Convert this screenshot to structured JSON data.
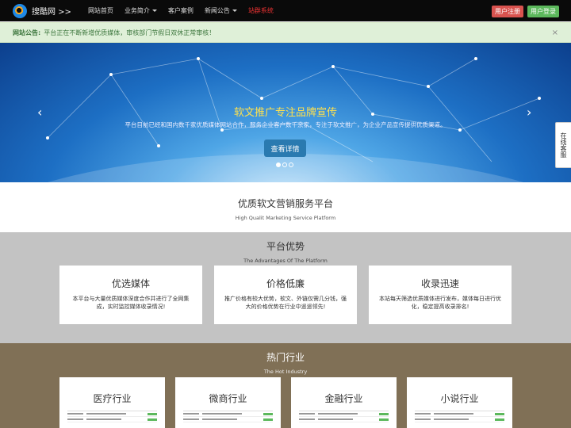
{
  "navbar": {
    "brand": "搜酷网 >>",
    "items": [
      {
        "label": "网站首页",
        "dropdown": false
      },
      {
        "label": "业务简介",
        "dropdown": true
      },
      {
        "label": "客户案例",
        "dropdown": false
      },
      {
        "label": "新闻公告",
        "dropdown": true
      },
      {
        "label": "站群系统",
        "dropdown": false,
        "highlight": true
      }
    ],
    "register": "用户注册",
    "login": "用户登录"
  },
  "notice": {
    "label": "网站公告:",
    "text": "平台正在不断新增优质媒体，审核部门节假日双休正常审核！",
    "close": "×"
  },
  "carousel": {
    "title": "软文推广专注品牌宣传",
    "subtitle": "平台目前已经和国内数千家优质媒体网站合作，服务企业客户数千余家，专注于软文推广，为企业产品宣传提供优质渠道。",
    "button": "查看详情",
    "prev": "‹",
    "next": "›",
    "side_tab": "在线客服"
  },
  "platform": {
    "title": "优质软文营销服务平台",
    "subtitle": "High Qualit Marketing Service Platform"
  },
  "advantages": {
    "title": "平台优势",
    "subtitle": "The Advantages Of The Platform",
    "cards": [
      {
        "title": "优选媒体",
        "text": "本平台与大量优质媒体深度合作并进行了全网集成，实时监控媒体收录情况!"
      },
      {
        "title": "价格低廉",
        "text": "推广价格有较大优势，软文、外链仅需几分钱，强大的价格优势在行业中遥遥领先!"
      },
      {
        "title": "收录迅速",
        "text": "本站每天筛选优质媒体进行发布，媒体每日进行优化，稳定提高收录排名!"
      }
    ]
  },
  "hot": {
    "title": "热门行业",
    "subtitle": "The Hot Industry",
    "cards": [
      {
        "title": "医疗行业"
      },
      {
        "title": "微商行业"
      },
      {
        "title": "金融行业"
      },
      {
        "title": "小说行业"
      }
    ]
  },
  "colors": {
    "navbar": "#0a0a0a",
    "notice_bg": "#dff0d8",
    "advantages_bg": "#c3c3c3",
    "hot_bg": "#807056",
    "register": "#d9534f",
    "login": "#5cb85c"
  }
}
